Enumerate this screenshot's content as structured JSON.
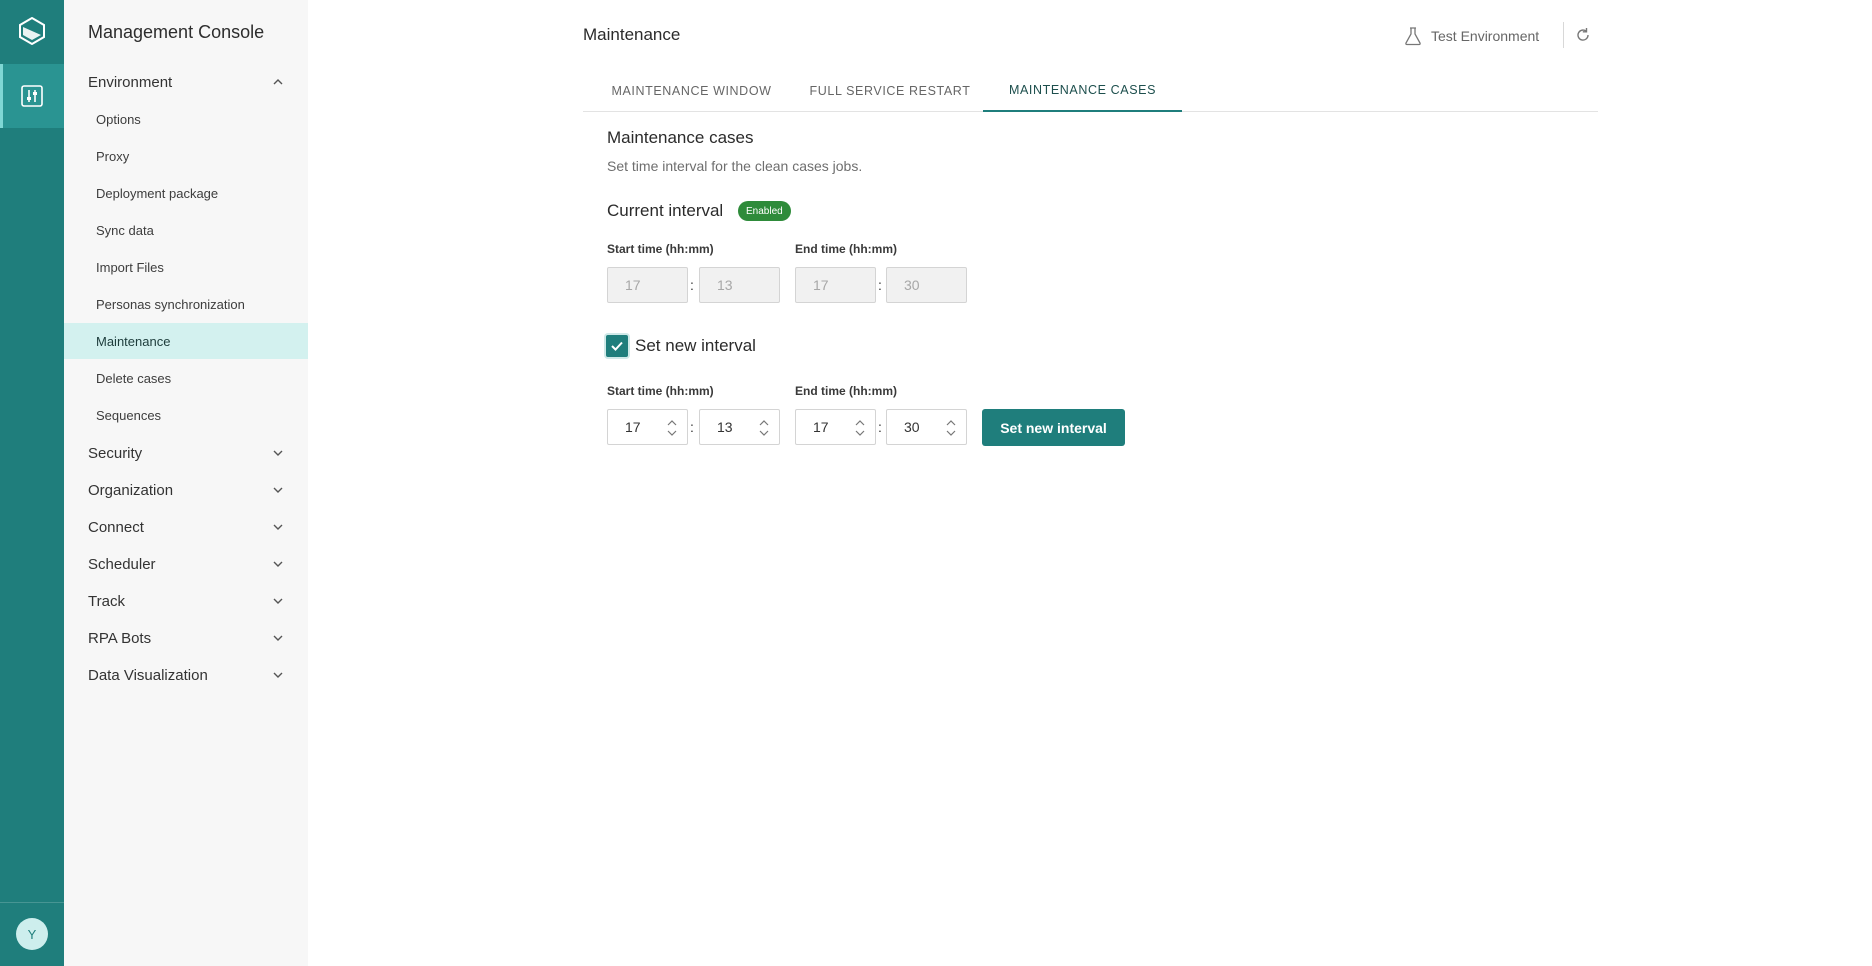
{
  "app": {
    "title": "Management Console"
  },
  "user": {
    "avatar_initial": "Y"
  },
  "sidebar": {
    "groups": [
      {
        "label": "Environment",
        "expanded": true
      },
      {
        "label": "Security"
      },
      {
        "label": "Organization"
      },
      {
        "label": "Connect"
      },
      {
        "label": "Scheduler"
      },
      {
        "label": "Track"
      },
      {
        "label": "RPA Bots"
      },
      {
        "label": "Data Visualization"
      }
    ],
    "environment_items": [
      {
        "label": "Options"
      },
      {
        "label": "Proxy"
      },
      {
        "label": "Deployment package"
      },
      {
        "label": "Sync data"
      },
      {
        "label": "Import Files"
      },
      {
        "label": "Personas synchronization"
      },
      {
        "label": "Maintenance",
        "active": true
      },
      {
        "label": "Delete cases"
      },
      {
        "label": "Sequences"
      }
    ]
  },
  "header": {
    "title": "Maintenance",
    "environment": "Test Environment"
  },
  "tabs": [
    {
      "label": "MAINTENANCE WINDOW"
    },
    {
      "label": "FULL SERVICE RESTART"
    },
    {
      "label": "MAINTENANCE CASES",
      "active": true
    }
  ],
  "section": {
    "title": "Maintenance cases",
    "description": "Set time interval for the clean cases jobs."
  },
  "current_interval": {
    "title": "Current interval",
    "status": "Enabled",
    "start_label": "Start time (hh:mm)",
    "end_label": "End time (hh:mm)",
    "start_hour": "17",
    "start_minute": "13",
    "end_hour": "17",
    "end_minute": "30"
  },
  "new_interval": {
    "checkbox_label": "Set new interval",
    "checked": true,
    "start_label": "Start time (hh:mm)",
    "end_label": "End time (hh:mm)",
    "start_hour": "17",
    "start_minute": "13",
    "end_hour": "17",
    "end_minute": "30",
    "button_label": "Set new interval"
  },
  "colors": {
    "rail": "#1f7e7c",
    "accent": "#1f7e7c",
    "active_item_bg": "#d3f1ef",
    "badge": "#2e8b3a"
  }
}
